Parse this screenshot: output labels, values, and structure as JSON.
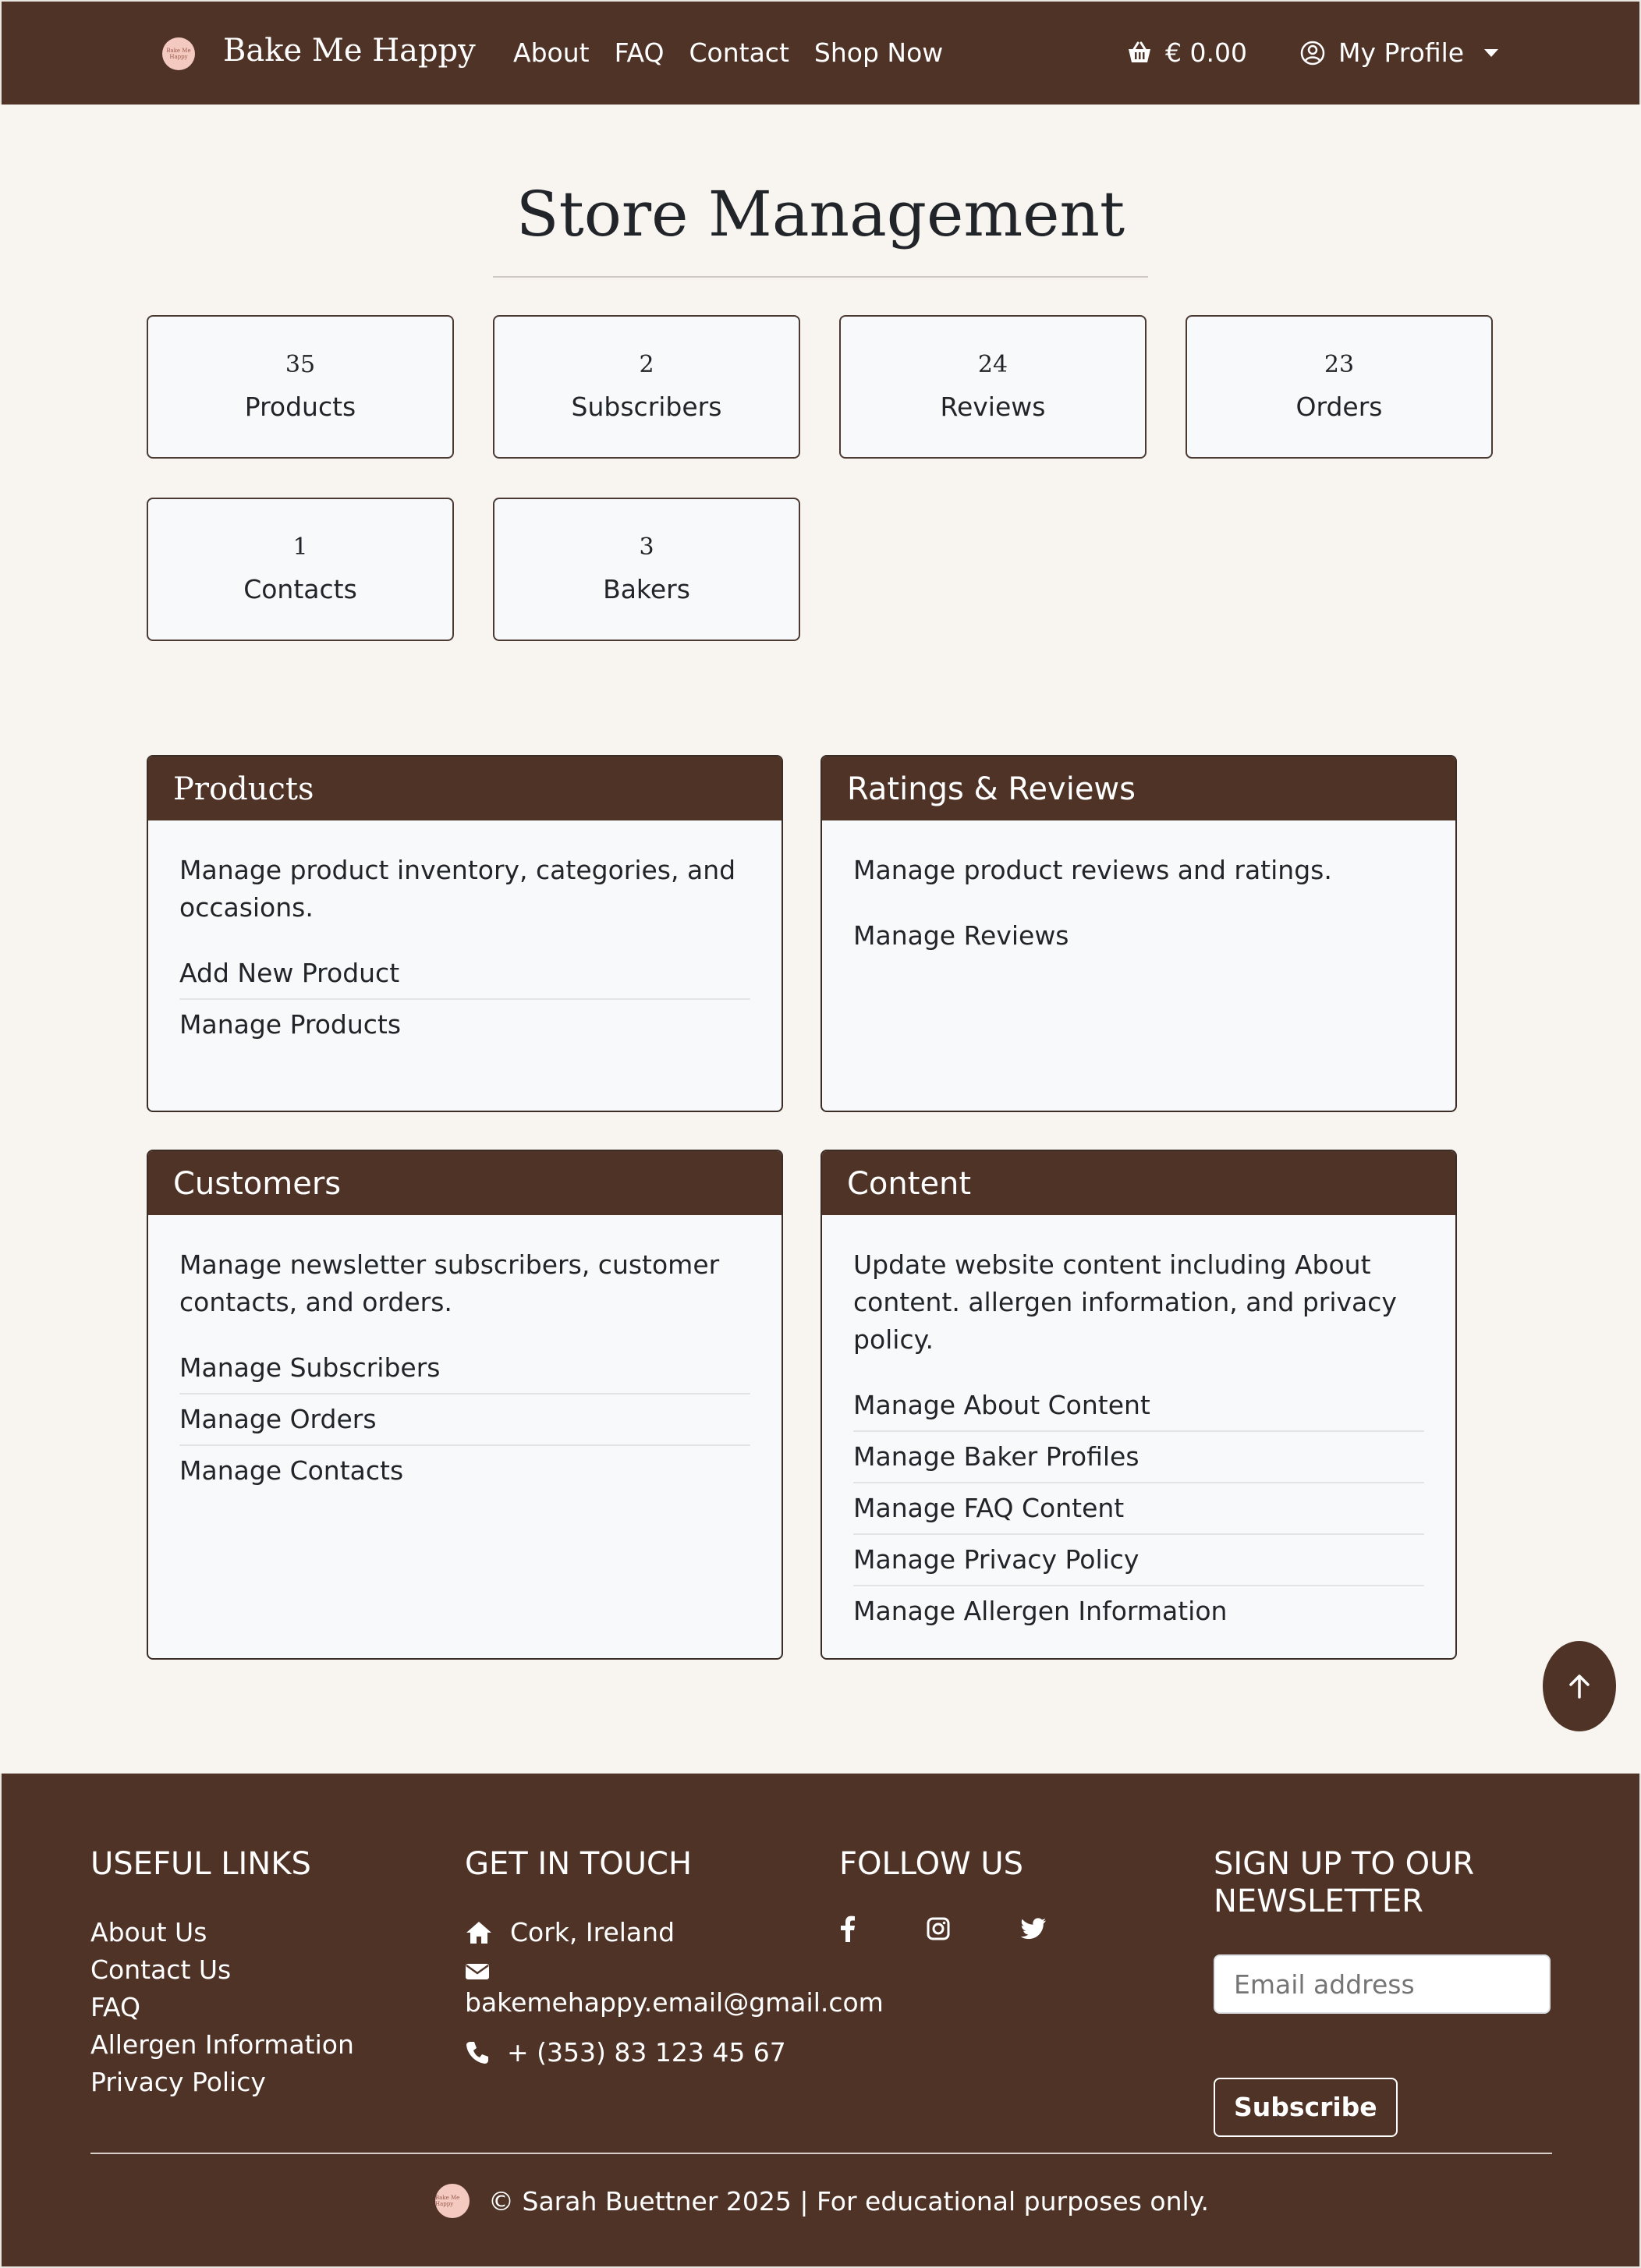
{
  "navbar": {
    "brand": "Bake Me Happy",
    "logo_text": "Bake Me Happy",
    "links": [
      "About",
      "FAQ",
      "Contact",
      "Shop Now"
    ],
    "cart_total": "€ 0.00",
    "profile_label": "My Profile"
  },
  "page": {
    "title": "Store Management"
  },
  "stats": [
    {
      "value": "35",
      "label": "Products"
    },
    {
      "value": "2",
      "label": "Subscribers"
    },
    {
      "value": "24",
      "label": "Reviews"
    },
    {
      "value": "23",
      "label": "Orders"
    },
    {
      "value": "1",
      "label": "Contacts"
    },
    {
      "value": "3",
      "label": "Bakers"
    }
  ],
  "sections": {
    "products": {
      "title": "Products",
      "description": "Manage product inventory, categories, and occasions.",
      "links": [
        "Add New Product",
        "Manage Products"
      ]
    },
    "reviews": {
      "title": "Ratings & Reviews",
      "description": "Manage product reviews and ratings.",
      "links": [
        "Manage Reviews"
      ]
    },
    "customers": {
      "title": "Customers",
      "description": "Manage newsletter subscribers, customer contacts, and orders.",
      "links": [
        "Manage Subscribers",
        "Manage Orders",
        "Manage Contacts"
      ]
    },
    "content": {
      "title": "Content",
      "description": "Update website content including About content. allergen information, and privacy policy.",
      "links": [
        "Manage About Content",
        "Manage Baker Profiles",
        "Manage FAQ Content",
        "Manage Privacy Policy",
        "Manage Allergen Information"
      ]
    }
  },
  "footer": {
    "useful_links_heading": "USEFUL LINKS",
    "useful_links": [
      "About Us",
      "Contact Us",
      "FAQ",
      "Allergen Information",
      "Privacy Policy"
    ],
    "touch_heading": "GET IN TOUCH",
    "location": "Cork, Ireland",
    "email": "bakemehappy.email@gmail.com",
    "phone": "+ (353) 83 123 45 67",
    "follow_heading": "FOLLOW US",
    "newsletter_heading": "SIGN UP TO OUR NEWSLETTER",
    "email_placeholder": "Email address",
    "subscribe_label": "Subscribe",
    "copyright": "© Sarah Buettner 2025 | For educational purposes only."
  },
  "colors": {
    "brand_brown": "#4f3327",
    "page_bg": "#f8f5f0",
    "card_bg": "#f8f9fa"
  },
  "icons": [
    "basket-icon",
    "user-circle-icon",
    "chevron-down-icon",
    "arrow-up-icon",
    "home-icon",
    "envelope-icon",
    "phone-icon",
    "facebook-icon",
    "instagram-icon",
    "twitter-icon"
  ]
}
